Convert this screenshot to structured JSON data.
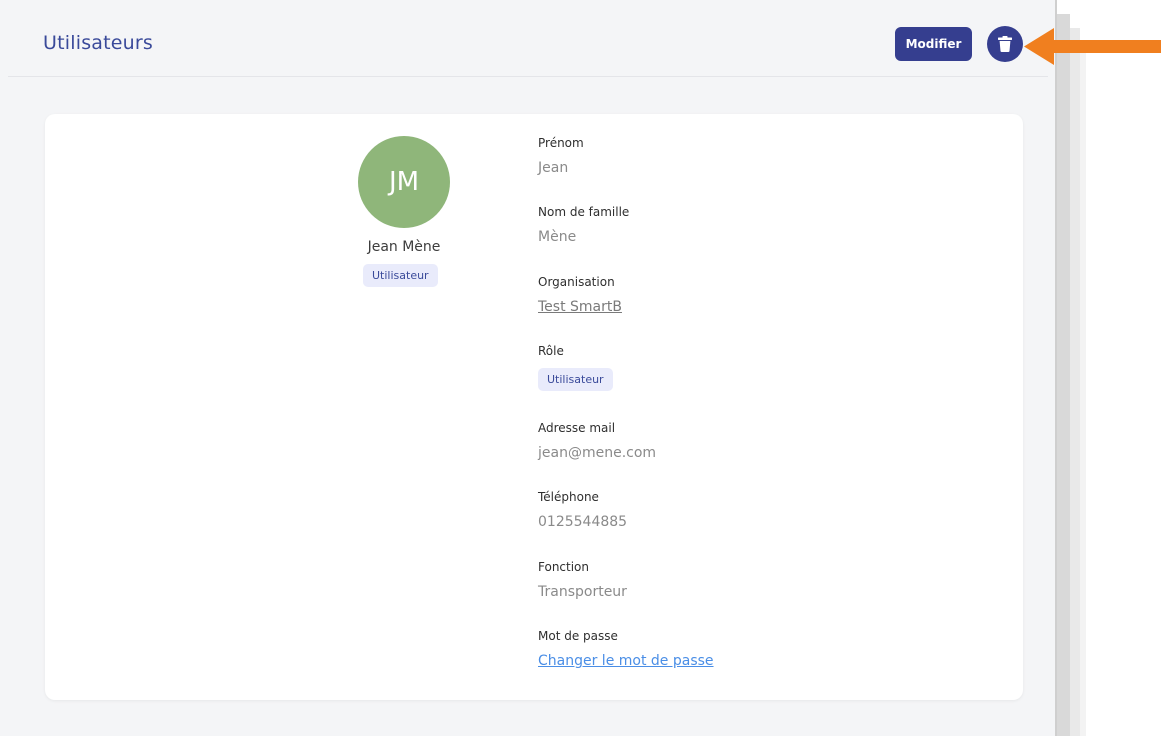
{
  "header": {
    "title": "Utilisateurs",
    "edit_label": "Modifier",
    "delete_icon": "trash-icon"
  },
  "profile": {
    "initials": "JM",
    "full_name": "Jean Mène",
    "role_badge": "Utilisateur",
    "avatar_color": "#8fb67a"
  },
  "fields": {
    "first_name": {
      "label": "Prénom",
      "value": "Jean"
    },
    "last_name": {
      "label": "Nom de famille",
      "value": "Mène"
    },
    "organization": {
      "label": "Organisation",
      "value": "Test SmartB"
    },
    "role": {
      "label": "Rôle",
      "value": "Utilisateur"
    },
    "email": {
      "label": "Adresse mail",
      "value": "jean@mene.com"
    },
    "phone": {
      "label": "Téléphone",
      "value": "0125544885"
    },
    "function": {
      "label": "Fonction",
      "value": "Transporteur"
    },
    "password": {
      "label": "Mot de passe",
      "link": "Changer le mot de passe"
    }
  },
  "colors": {
    "primary": "#353e8f",
    "title": "#3a4a9a",
    "annotation_arrow": "#f07f1f",
    "link": "#4a8ee6"
  }
}
